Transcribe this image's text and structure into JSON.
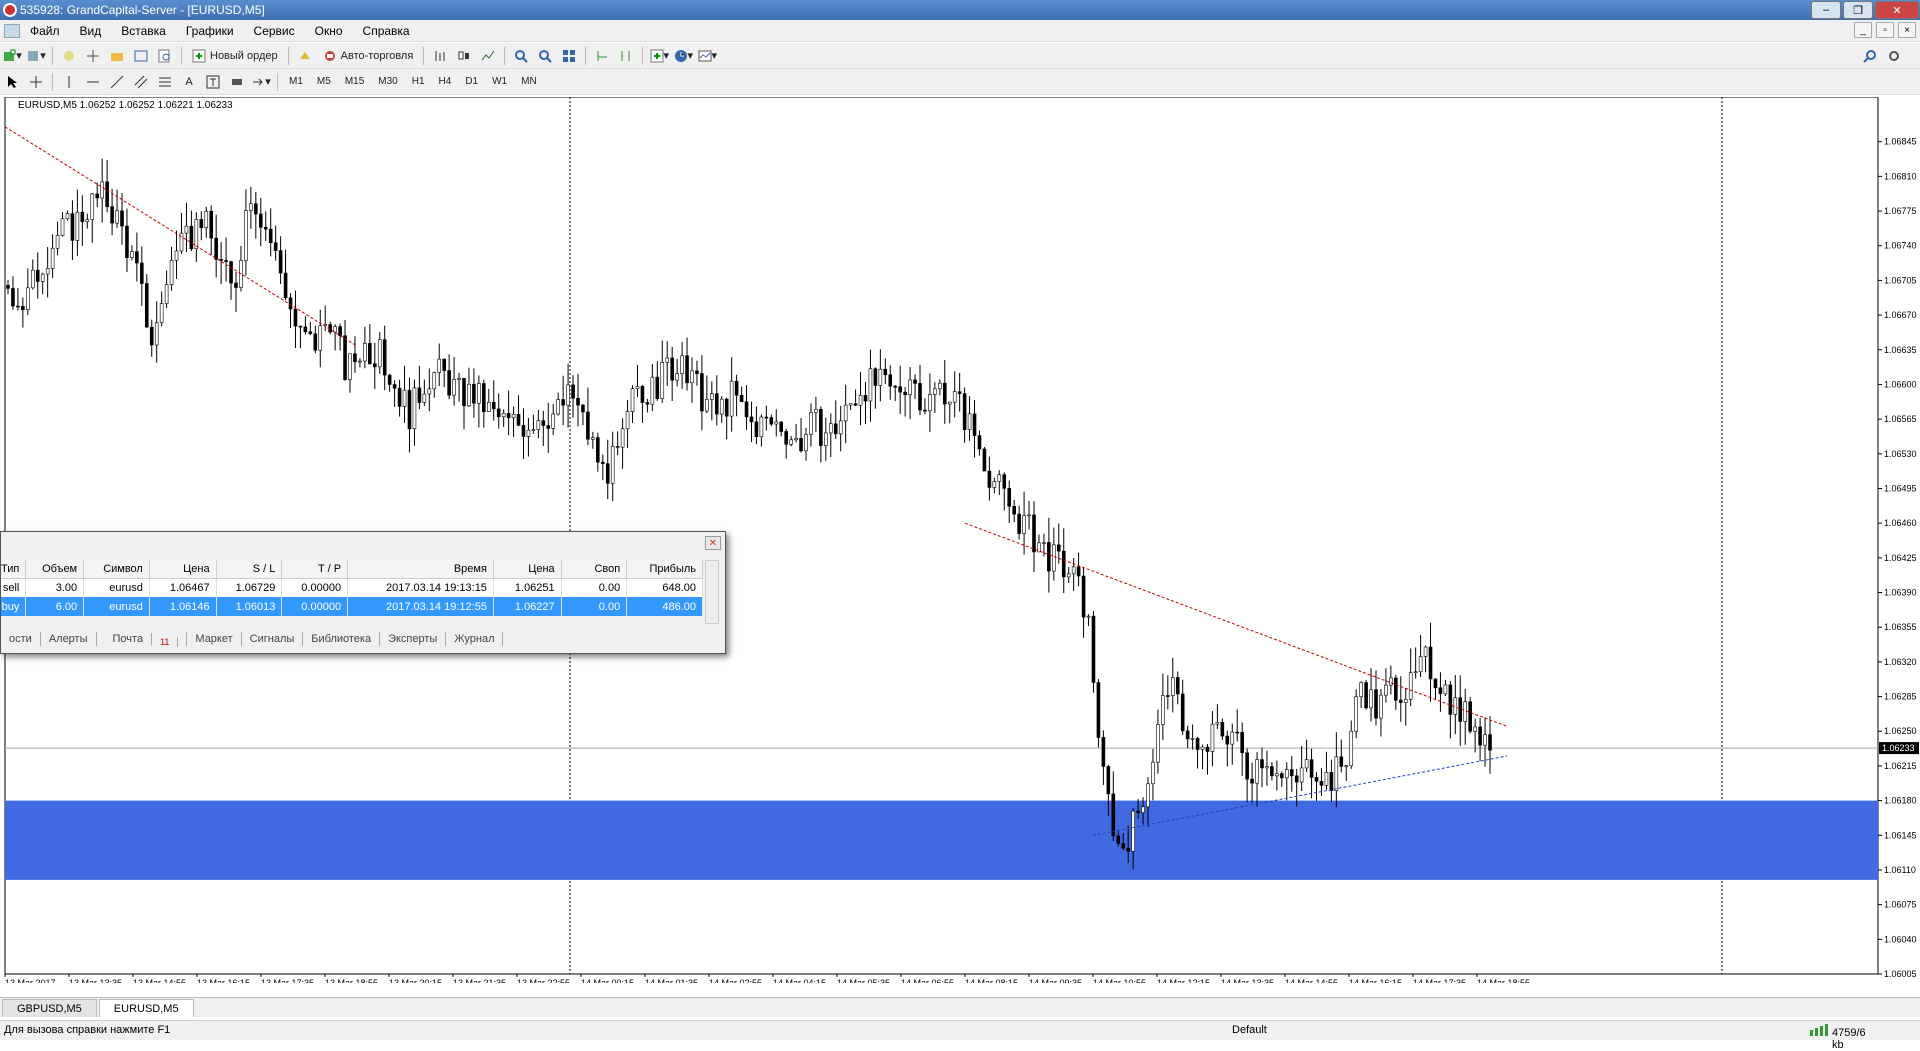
{
  "window": {
    "title": "535928: GrandCapital-Server - [EURUSD,M5]",
    "minimize": "–",
    "restore": "❐",
    "close": "✕"
  },
  "menu": {
    "items": [
      "Файл",
      "Вид",
      "Вставка",
      "Графики",
      "Сервис",
      "Окно",
      "Справка"
    ]
  },
  "toolbar": {
    "new_order": "Новый ордер",
    "auto_trading": "Авто-торговля",
    "timeframes": [
      "M1",
      "M5",
      "M15",
      "M30",
      "H1",
      "H4",
      "D1",
      "W1",
      "MN"
    ]
  },
  "chart": {
    "header": "EURUSD,M5  1.06252 1.06252 1.06221 1.06233",
    "current_price": "1.06233",
    "colors": {
      "zone": "#4169e1",
      "candles": "#000000",
      "trend_red": "#c00000",
      "trend_blue": "#2040c0"
    }
  },
  "chart_data": {
    "type": "candlestick",
    "symbol": "EURUSD",
    "timeframe": "M5",
    "ylim": [
      1.06005,
      1.0688
    ],
    "y_ticks": [
      "1.06845",
      "1.06810",
      "1.06775",
      "1.06740",
      "1.06705",
      "1.06670",
      "1.06635",
      "1.06600",
      "1.06565",
      "1.06530",
      "1.06495",
      "1.06460",
      "1.06425",
      "1.06390",
      "1.06355",
      "1.06320",
      "1.06285",
      "1.06250",
      "1.06215",
      "1.06180",
      "1.06145",
      "1.06110",
      "1.06075",
      "1.06040",
      "1.06005"
    ],
    "x_ticks": [
      "13 Mar 2017",
      "13 Mar 13:35",
      "13 Mar 14:55",
      "13 Mar 16:15",
      "13 Mar 17:35",
      "13 Mar 18:55",
      "13 Mar 20:15",
      "13 Mar 21:35",
      "13 Mar 22:55",
      "14 Mar 00:15",
      "14 Mar 01:35",
      "14 Mar 02:55",
      "14 Mar 04:15",
      "14 Mar 05:35",
      "14 Mar 06:55",
      "14 Mar 08:15",
      "14 Mar 09:35",
      "14 Mar 10:55",
      "14 Mar 12:15",
      "14 Mar 13:35",
      "14 Mar 14:55",
      "14 Mar 16:15",
      "14 Mar 17:35",
      "14 Mar 18:55"
    ],
    "close_path": [
      1.067,
      1.0668,
      1.0672,
      1.0675,
      1.0676,
      1.0678,
      1.0679,
      1.0676,
      1.0671,
      1.0664,
      1.0672,
      1.0674,
      1.0677,
      1.0673,
      1.0669,
      1.068,
      1.0676,
      1.0671,
      1.0665,
      1.0664,
      1.0667,
      1.0661,
      1.0664,
      1.0663,
      1.066,
      1.0657,
      1.0661,
      1.0661,
      1.0659,
      1.0659,
      1.0657,
      1.0656,
      1.0656,
      1.0657,
      1.0657,
      1.0659,
      1.0655,
      1.0651,
      1.0653,
      1.066,
      1.0659,
      1.0662,
      1.0661,
      1.0659,
      1.0657,
      1.0659,
      1.0656,
      1.0656,
      1.0656,
      1.0654,
      1.0656,
      1.0655,
      1.0657,
      1.066,
      1.066,
      1.0659,
      1.0661,
      1.0658,
      1.066,
      1.0658,
      1.0655,
      1.0651,
      1.0648,
      1.0646,
      1.0644,
      1.0642,
      1.0641,
      1.0637,
      1.062,
      1.0613,
      1.0616,
      1.0622,
      1.063,
      1.0626,
      1.0622,
      1.0625,
      1.0625,
      1.0621,
      1.0623,
      1.062,
      1.062,
      1.0622,
      1.062,
      1.0622,
      1.063,
      1.0627,
      1.063,
      1.0629,
      1.0632,
      1.063,
      1.0627,
      1.0626,
      1.0624
    ],
    "zone": {
      "from": 1.0618,
      "to": 1.061
    },
    "trendlines": [
      {
        "color": "red",
        "from": [
          "13 Mar 2017",
          1.0686
        ],
        "to": [
          "13 Mar 18:55",
          1.0664
        ]
      },
      {
        "color": "red",
        "from": [
          "14 Mar 08:15",
          1.0646
        ],
        "to": [
          "14 Mar 18:55",
          1.06255
        ]
      },
      {
        "color": "blue",
        "from": [
          "14 Mar 10:55",
          1.06145
        ],
        "to": [
          "14 Mar 18:55",
          1.06225
        ]
      }
    ]
  },
  "chart_tabs": [
    "GBPUSD,M5",
    "EURUSD,M5"
  ],
  "terminal": {
    "columns": [
      "Тип",
      "Объем",
      "Символ",
      "Цена",
      "S / L",
      "T / P",
      "Время",
      "Цена",
      "Своп",
      "Прибыль"
    ],
    "rows": [
      [
        "sell",
        "3.00",
        "eurusd",
        "1.06467",
        "1.06729",
        "0.00000",
        "2017.03.14 19:13:15",
        "1.06251",
        "0.00",
        "648.00"
      ],
      [
        "buy",
        "6.00",
        "eurusd",
        "1.06146",
        "1.06013",
        "0.00000",
        "2017.03.14 19:12:55",
        "1.06227",
        "0.00",
        "486.00"
      ]
    ],
    "tabs": [
      "ости",
      "Алерты",
      "Почта",
      "Маркет",
      "Сигналы",
      "Библиотека",
      "Эксперты",
      "Журнал"
    ],
    "mail_count": "11"
  },
  "status": {
    "help": "Для вызова справки нажмите F1",
    "profile": "Default",
    "traffic": "4759/6 kb"
  }
}
